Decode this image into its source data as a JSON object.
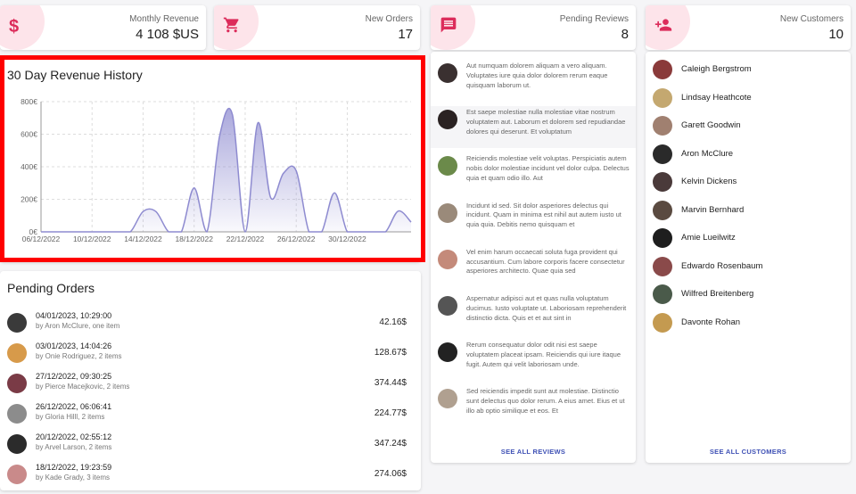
{
  "colors": {
    "accent": "#dc2c5b",
    "blob": "#fde4ea",
    "chart_line": "#8e8bd0",
    "link": "#3f51b5",
    "highlight": "#ff0000"
  },
  "stats": [
    {
      "label": "Monthly Revenue",
      "value": "4 108 $US",
      "icon": "dollar-icon"
    },
    {
      "label": "New Orders",
      "value": "17",
      "icon": "cart-icon"
    },
    {
      "label": "Pending Reviews",
      "value": "8",
      "icon": "comment-icon"
    },
    {
      "label": "New Customers",
      "value": "10",
      "icon": "person-add-icon"
    }
  ],
  "revenue_chart": {
    "title": "30 Day Revenue History"
  },
  "chart_data": {
    "type": "area",
    "title": "30 Day Revenue History",
    "xlabel": "",
    "ylabel": "",
    "x_ticks": [
      "06/12/2022",
      "10/12/2022",
      "14/12/2022",
      "18/12/2022",
      "22/12/2022",
      "26/12/2022",
      "30/12/2022"
    ],
    "y_ticks": [
      "0€",
      "200€",
      "400€",
      "600€",
      "800€"
    ],
    "ylim": [
      0,
      800
    ],
    "grid": true,
    "series": [
      {
        "x": [
          "06/12/2022",
          "07/12/2022",
          "08/12/2022",
          "09/12/2022",
          "10/12/2022",
          "11/12/2022",
          "12/12/2022",
          "13/12/2022",
          "14/12/2022",
          "15/12/2022",
          "16/12/2022",
          "17/12/2022",
          "18/12/2022",
          "19/12/2022",
          "20/12/2022",
          "21/12/2022",
          "22/12/2022",
          "23/12/2022",
          "24/12/2022",
          "25/12/2022",
          "26/12/2022",
          "27/12/2022",
          "28/12/2022",
          "29/12/2022",
          "30/12/2022",
          "31/12/2022",
          "01/01/2023",
          "02/01/2023",
          "03/01/2023",
          "04/01/2023"
        ],
        "values": [
          0,
          0,
          0,
          0,
          0,
          0,
          0,
          0,
          125,
          125,
          0,
          0,
          270,
          0,
          590,
          720,
          0,
          670,
          210,
          360,
          375,
          0,
          0,
          240,
          0,
          0,
          0,
          0,
          128,
          60
        ]
      }
    ]
  },
  "pending_orders": {
    "title": "Pending Orders",
    "rows": [
      {
        "date": "04/01/2023, 10:29:00",
        "by": "by Aron McClure, one item",
        "total": "42.16$",
        "avatar_color": "#3a3a3a"
      },
      {
        "date": "03/01/2023, 14:04:26",
        "by": "by Onie Rodriguez, 2 items",
        "total": "128.67$",
        "avatar_color": "#d79a4a"
      },
      {
        "date": "27/12/2022, 09:30:25",
        "by": "by Pierce Macejkovic, 2 items",
        "total": "374.44$",
        "avatar_color": "#7a3b46"
      },
      {
        "date": "26/12/2022, 06:06:41",
        "by": "by Gloria Hilll, 2 items",
        "total": "224.77$",
        "avatar_color": "#8c8c8c"
      },
      {
        "date": "20/12/2022, 02:55:12",
        "by": "by Arvel Larson, 2 items",
        "total": "347.24$",
        "avatar_color": "#2b2b2b"
      },
      {
        "date": "18/12/2022, 19:23:59",
        "by": "by Kade Grady, 3 items",
        "total": "274.06$",
        "avatar_color": "#c98a8a"
      }
    ]
  },
  "reviews": {
    "see_all": "SEE ALL REVIEWS",
    "rows": [
      {
        "text": "Aut numquam dolorem aliquam a vero aliquam. Voluptates iure quia dolor dolorem rerum eaque quisquam laborum ut.",
        "avatar_color": "#3a3030"
      },
      {
        "text": "Est saepe molestiae nulla molestiae vitae nostrum voluptatem aut. Laborum et dolorem sed repudiandae dolores qui deserunt. Et voluptatum",
        "avatar_color": "#2a2222"
      },
      {
        "text": "Reiciendis molestiae velit voluptas. Perspiciatis autem nobis dolor molestiae incidunt vel dolor culpa. Delectus quia et quam odio illo. Aut",
        "avatar_color": "#6b8a4a"
      },
      {
        "text": "Incidunt id sed. Sit dolor asperiores delectus qui incidunt. Quam in minima est nihil aut autem iusto ut quia quia. Debitis nemo quisquam et",
        "avatar_color": "#9a8a7a"
      },
      {
        "text": "Vel enim harum occaecati soluta fuga provident qui accusantium. Cum labore corporis facere consectetur asperiores architecto. Quae quia sed",
        "avatar_color": "#c48a7a"
      },
      {
        "text": "Aspernatur adipisci aut et quas nulla voluptatum ducimus. Iusto voluptate ut. Laboriosam reprehenderit distinctio dicta. Quis et et aut sint in",
        "avatar_color": "#555555"
      },
      {
        "text": "Rerum consequatur dolor odit nisi est saepe voluptatem placeat ipsam. Reiciendis qui iure itaque fugit. Autem qui velit laboriosam unde.",
        "avatar_color": "#222222"
      },
      {
        "text": "Sed reiciendis impedit sunt aut molestiae. Distinctio sunt delectus quo dolor rerum. A eius amet. Eius et ut illo ab optio similique et eos. Et",
        "avatar_color": "#b0a090"
      }
    ]
  },
  "customers": {
    "see_all": "SEE ALL CUSTOMERS",
    "rows": [
      {
        "name": "Caleigh Bergstrom",
        "avatar_color": "#8a3a3a"
      },
      {
        "name": "Lindsay Heathcote",
        "avatar_color": "#c4a870"
      },
      {
        "name": "Garett Goodwin",
        "avatar_color": "#a08070"
      },
      {
        "name": "Aron McClure",
        "avatar_color": "#2a2a2a"
      },
      {
        "name": "Kelvin Dickens",
        "avatar_color": "#4a3a3a"
      },
      {
        "name": "Marvin Bernhard",
        "avatar_color": "#5a4a40"
      },
      {
        "name": "Amie Lueilwitz",
        "avatar_color": "#1e1e1e"
      },
      {
        "name": "Edwardo Rosenbaum",
        "avatar_color": "#8a4a4a"
      },
      {
        "name": "Wilfred Breitenberg",
        "avatar_color": "#4a5a4a"
      },
      {
        "name": "Davonte Rohan",
        "avatar_color": "#c49a50"
      }
    ]
  }
}
